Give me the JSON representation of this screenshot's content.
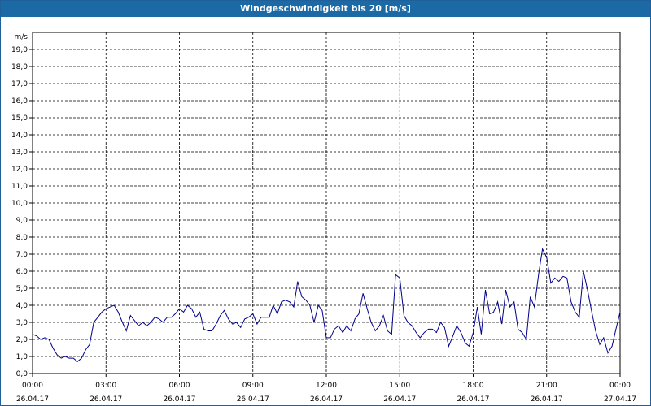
{
  "window": {
    "title": "Windgeschwindigkeit bis 20 [m/s]"
  },
  "chart_data": {
    "type": "line",
    "title": "Windgeschwindigkeit bis 20 [m/s]",
    "ylabel": "m/s",
    "xlabel": "",
    "ylim": [
      0,
      20
    ],
    "xlim_hours": [
      0,
      24
    ],
    "grid": true,
    "y_ticks": [
      "0,0",
      "1,0",
      "2,0",
      "3,0",
      "4,0",
      "5,0",
      "6,0",
      "7,0",
      "8,0",
      "9,0",
      "10,0",
      "11,0",
      "12,0",
      "13,0",
      "14,0",
      "15,0",
      "16,0",
      "17,0",
      "18,0",
      "19,0"
    ],
    "x_ticks": [
      {
        "time": "00:00",
        "date": "26.04.17"
      },
      {
        "time": "03:00",
        "date": "26.04.17"
      },
      {
        "time": "06:00",
        "date": "26.04.17"
      },
      {
        "time": "09:00",
        "date": "26.04.17"
      },
      {
        "time": "12:00",
        "date": "26.04.17"
      },
      {
        "time": "15:00",
        "date": "26.04.17"
      },
      {
        "time": "18:00",
        "date": "26.04.17"
      },
      {
        "time": "21:00",
        "date": "26.04.17"
      },
      {
        "time": "00:00",
        "date": "27.04.17"
      }
    ],
    "series": [
      {
        "color": "#00008b",
        "x_hours": [
          0,
          0.17,
          0.33,
          0.5,
          0.67,
          0.83,
          1.0,
          1.17,
          1.33,
          1.5,
          1.67,
          1.83,
          2.0,
          2.17,
          2.33,
          2.5,
          2.67,
          2.83,
          3.0,
          3.17,
          3.33,
          3.5,
          3.67,
          3.83,
          4.0,
          4.17,
          4.33,
          4.5,
          4.67,
          4.83,
          5.0,
          5.17,
          5.33,
          5.5,
          5.67,
          5.83,
          6.0,
          6.17,
          6.33,
          6.5,
          6.67,
          6.83,
          7.0,
          7.17,
          7.33,
          7.5,
          7.67,
          7.83,
          8.0,
          8.17,
          8.33,
          8.5,
          8.67,
          8.83,
          9.0,
          9.17,
          9.33,
          9.5,
          9.67,
          9.83,
          10.0,
          10.17,
          10.33,
          10.5,
          10.67,
          10.83,
          11.0,
          11.17,
          11.33,
          11.5,
          11.67,
          11.83,
          12.0,
          12.17,
          12.33,
          12.5,
          12.67,
          12.83,
          13.0,
          13.17,
          13.33,
          13.5,
          13.67,
          13.83,
          14.0,
          14.17,
          14.33,
          14.5,
          14.67,
          14.83,
          15.0,
          15.17,
          15.33,
          15.5,
          15.67,
          15.83,
          16.0,
          16.17,
          16.33,
          16.5,
          16.67,
          16.83,
          17.0,
          17.17,
          17.33,
          17.5,
          17.67,
          17.83,
          18.0,
          18.17,
          18.33,
          18.5,
          18.67,
          18.83,
          19.0,
          19.17,
          19.33,
          19.5,
          19.67,
          19.83,
          20.0,
          20.17,
          20.33,
          20.5,
          20.67,
          20.83,
          21.0,
          21.17,
          21.33,
          21.5,
          21.67,
          21.83,
          22.0,
          22.17,
          22.33,
          22.5,
          22.67,
          22.83,
          23.0,
          23.17,
          23.33,
          23.5,
          23.67,
          23.83,
          24.0
        ],
        "values": [
          2.3,
          2.2,
          2.0,
          2.1,
          2.0,
          1.5,
          1.1,
          0.9,
          1.0,
          0.9,
          0.9,
          0.7,
          0.9,
          1.4,
          1.7,
          3.0,
          3.3,
          3.6,
          3.8,
          3.9,
          4.0,
          3.6,
          3.0,
          2.5,
          3.4,
          3.1,
          2.8,
          3.0,
          2.8,
          3.0,
          3.3,
          3.2,
          3.0,
          3.3,
          3.3,
          3.5,
          3.8,
          3.6,
          4.0,
          3.8,
          3.3,
          3.6,
          2.6,
          2.5,
          2.5,
          2.9,
          3.4,
          3.7,
          3.2,
          2.9,
          3.0,
          2.7,
          3.2,
          3.3,
          3.5,
          2.9,
          3.3,
          3.3,
          3.3,
          4.0,
          3.5,
          4.2,
          4.3,
          4.2,
          3.9,
          5.4,
          4.5,
          4.3,
          4.0,
          3.0,
          4.0,
          3.7,
          2.1,
          2.1,
          2.6,
          2.8,
          2.4,
          2.8,
          2.5,
          3.2,
          3.5,
          4.7,
          3.8,
          3.0,
          2.5,
          2.8,
          3.4,
          2.5,
          2.3,
          5.8,
          5.6,
          3.4,
          3.0,
          2.8,
          2.4,
          2.1,
          2.4,
          2.6,
          2.6,
          2.4,
          3.0,
          2.7,
          1.6,
          2.2,
          2.8,
          2.4,
          1.8,
          1.6,
          2.4,
          3.9,
          2.3,
          4.9,
          3.5,
          3.6,
          4.2,
          2.9,
          4.9,
          3.9,
          4.2,
          2.6,
          2.4,
          2.0,
          4.5,
          3.9,
          5.8,
          7.3,
          6.8,
          5.3,
          5.6,
          5.4,
          5.7,
          5.6,
          4.2,
          3.6,
          3.3,
          6.0,
          4.9,
          3.7,
          2.5,
          1.7,
          2.1,
          1.2,
          1.6,
          2.6,
          3.6
        ]
      }
    ]
  }
}
